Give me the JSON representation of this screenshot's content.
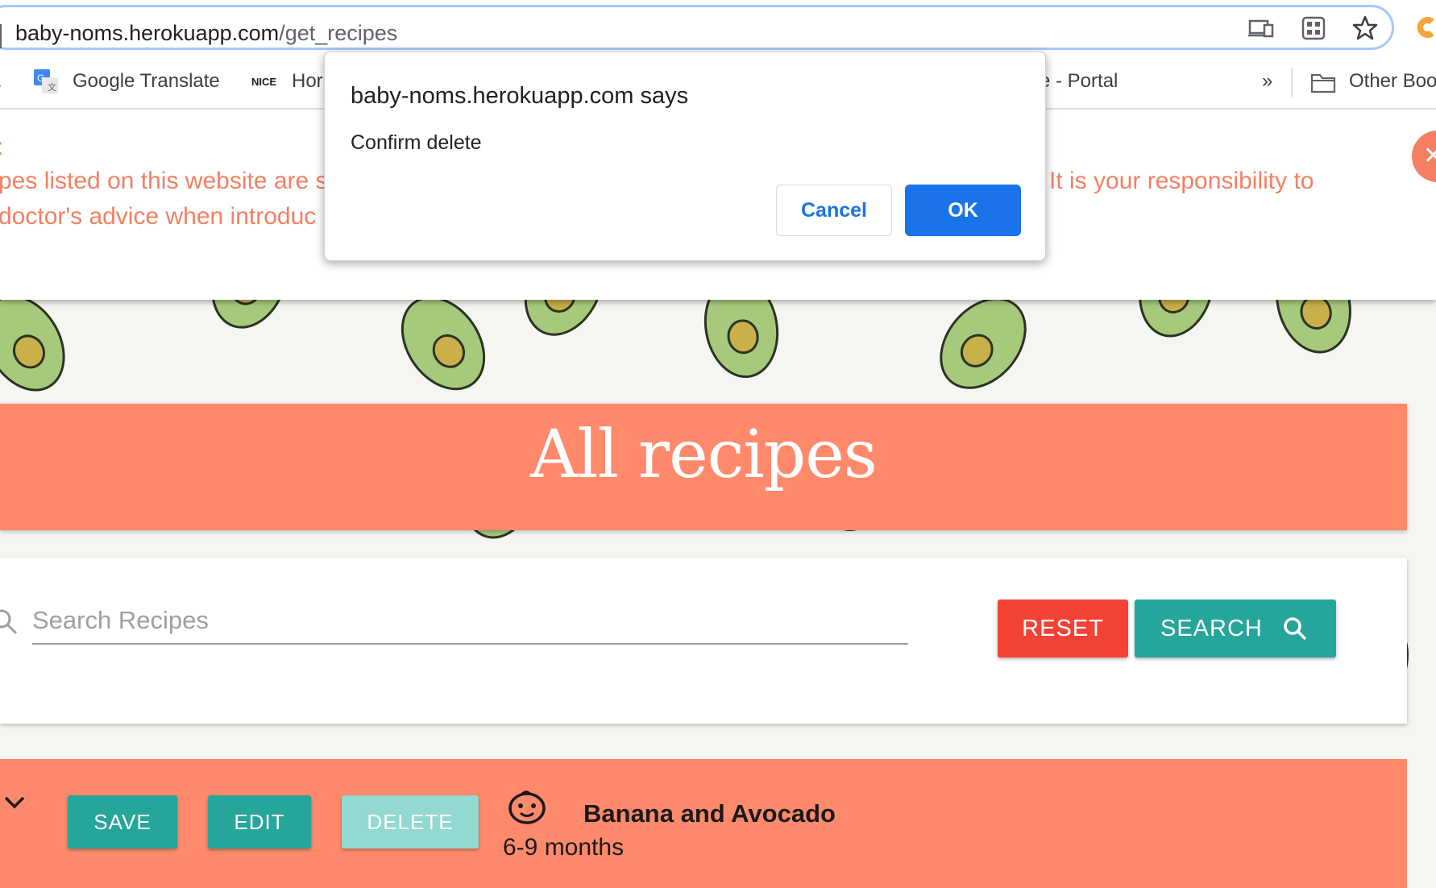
{
  "browser": {
    "url_host": "baby-noms.herokuapp.com",
    "url_path": "/get_recipes",
    "bookmarks": [
      {
        "label": "Google Translate"
      },
      {
        "label": "Hor"
      },
      {
        "label": "e - Portal"
      },
      {
        "label": "»"
      },
      {
        "label": "Other Boo"
      }
    ],
    "bookmark_badge": "NICE"
  },
  "disclaimer": {
    "title_fragment": ":",
    "line1_left": "pes listed on this website are s",
    "line1_right": "It is your responsibility to",
    "line2_left": " doctor's advice when introduc"
  },
  "header": {
    "title": "All recipes"
  },
  "search": {
    "placeholder": "Search Recipes",
    "reset_label": "RESET",
    "search_label": "SEARCH"
  },
  "recipe": {
    "save_label": "SAVE",
    "edit_label": "EDIT",
    "delete_label": "DELETE",
    "name": "Banana and Avocado",
    "age": "6-9 months"
  },
  "dialog": {
    "title": "baby-noms.herokuapp.com says",
    "message": "Confirm delete",
    "cancel_label": "Cancel",
    "ok_label": "OK"
  },
  "colors": {
    "accent": "#ff8a6b",
    "teal": "#26a69a",
    "reset_red": "#f44336",
    "dialog_blue": "#1a73e8"
  }
}
